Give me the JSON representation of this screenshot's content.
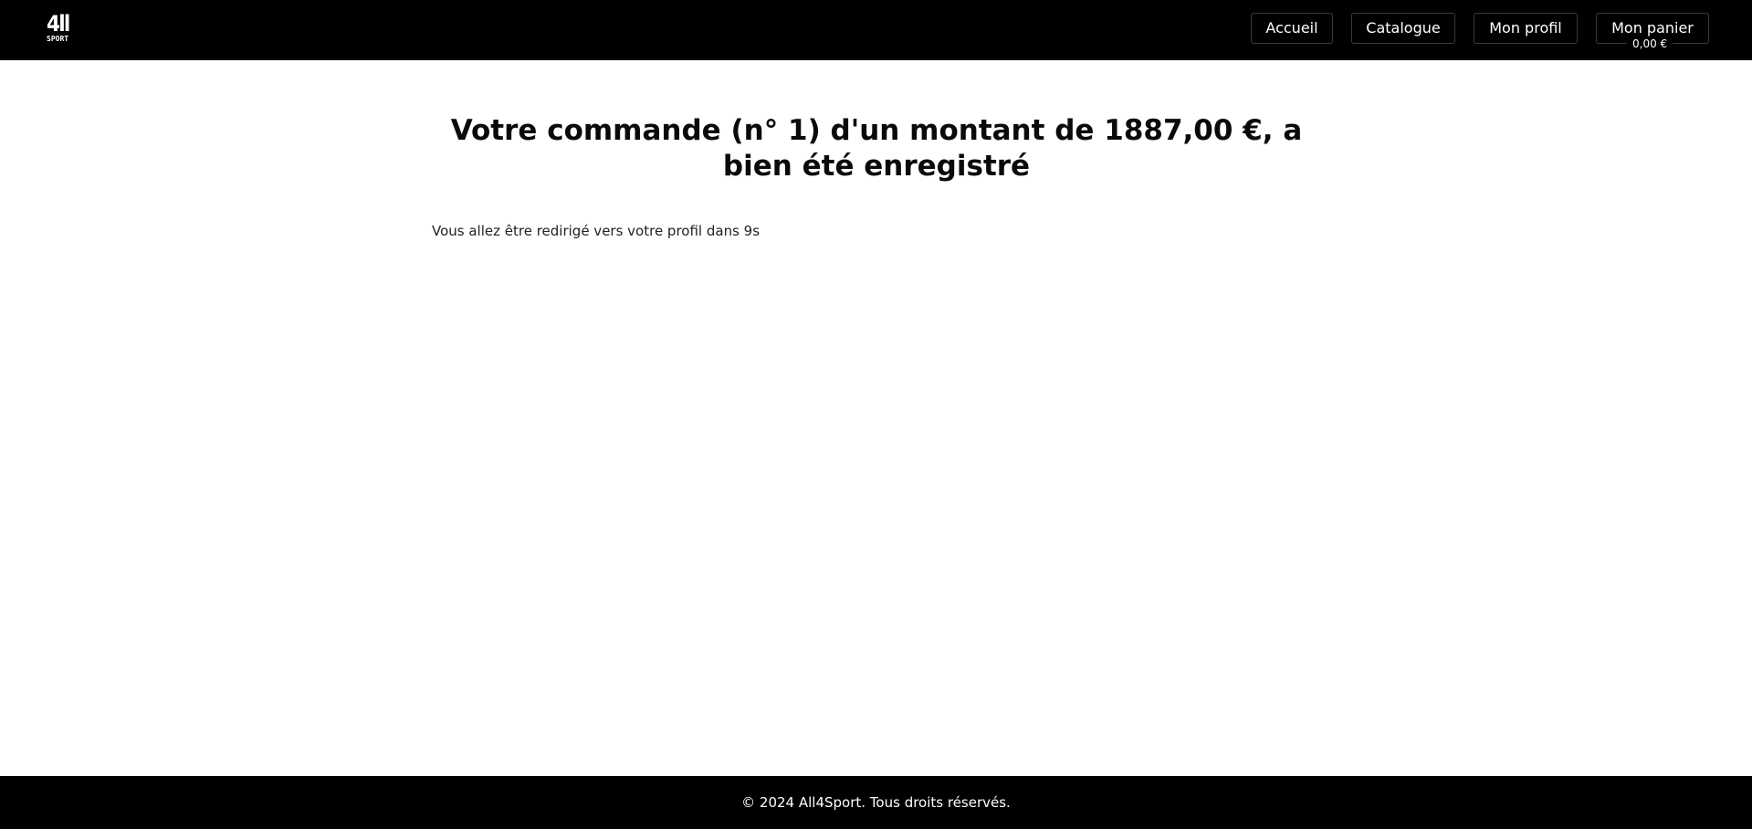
{
  "header": {
    "logo": {
      "top_text": "4ll",
      "bottom_text": "SPORT"
    },
    "nav": {
      "home_label": "Accueil",
      "catalogue_label": "Catalogue",
      "profile_label": "Mon profil",
      "cart_label": "Mon panier",
      "cart_total": "0,00 €"
    }
  },
  "main": {
    "title": "Votre commande (n° 1) d'un montant de 1887,00 €, a bien été enregistré",
    "redirect_message": "Vous allez être redirigé vers votre profil dans 9s"
  },
  "footer": {
    "copyright": "© 2024 All4Sport. Tous droits réservés."
  },
  "colors": {
    "header_bg": "#000000",
    "footer_bg": "#000000",
    "page_bg": "#ffffff",
    "text": "#0a0a0a"
  }
}
